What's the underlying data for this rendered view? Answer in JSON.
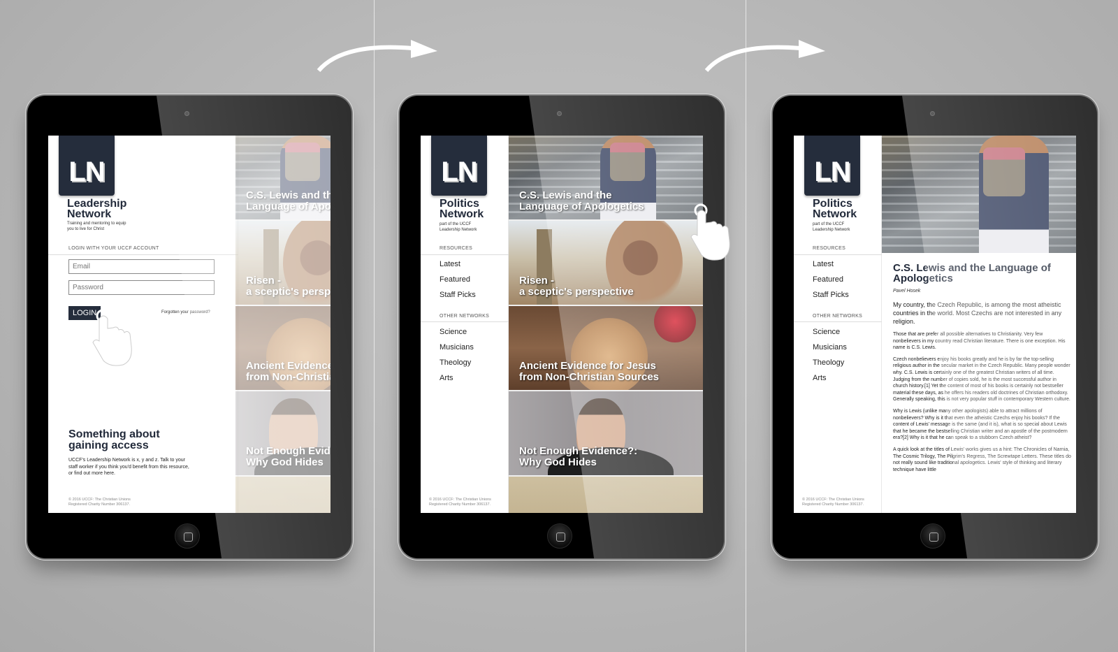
{
  "brand_color": "#252d3c",
  "panels": [
    {
      "screen": "login",
      "logo": "LN",
      "brand_name": "Leadership Network",
      "brand_tagline": "Training and mentoring to equip you to live for Christ",
      "login": {
        "section_label": "LOGIN WITH YOUR UCCF ACCOUNT",
        "email_placeholder": "Email",
        "password_placeholder": "Password",
        "login_button": "LOGIN",
        "forgot_link": "Forgotten your password?"
      },
      "access": {
        "title": "Something about gaining access",
        "text": "UCCF's Leadership Network is x, y and z. Talk to your staff worker if you think you'd benefit from this resource, or find out more here."
      },
      "footer": [
        "© 2016 UCCF: The Christian Unions",
        "Registered Charity Number 306137."
      ]
    },
    {
      "screen": "listing",
      "logo": "LN",
      "brand_name": "Politics Network",
      "brand_tagline": "part of the UCCF Leadership Network",
      "resources_label": "RESOURCES",
      "resources": [
        "Latest",
        "Featured",
        "Staff Picks"
      ],
      "other_networks_label": "OTHER NETWORKS",
      "other_networks": [
        "Science",
        "Musicians",
        "Theology",
        "Arts"
      ],
      "footer": [
        "© 2016 UCCF: The Christian Unions",
        "Registered Charity Number 306137."
      ]
    },
    {
      "screen": "article",
      "logo": "LN",
      "brand_name": "Politics Network",
      "brand_tagline": "part of the UCCF Leadership Network",
      "resources_label": "RESOURCES",
      "resources": [
        "Latest",
        "Featured",
        "Staff Picks"
      ],
      "other_networks_label": "OTHER NETWORKS",
      "other_networks": [
        "Science",
        "Musicians",
        "Theology",
        "Arts"
      ],
      "footer": [
        "© 2016 UCCF: The Christian Unions",
        "Registered Charity Number 306137."
      ],
      "article": {
        "title": "C.S. Lewis and the Language of Apologetics",
        "author": "Pavel Hosek",
        "lead": "My country, the Czech Republic, is among the most atheistic countries in the world. Most Czechs are not interested in any religion.",
        "paragraphs": [
          "Those that are prefer all possible alternatives to Christianity. Very few nonbelievers in my country read Christian literature. There is one exception. His name is C.S. Lewis.",
          "Czech nonbelievers enjoy his books greatly and he is by far the top-selling religious author in the secular market in the Czech Republic. Many people wonder why. C.S. Lewis is certainly one of the greatest Christian writers of all time. Judging from the number of copies sold, he is the most successful author in church history.[1] Yet the content of most of his books is certainly not bestseller material these days, as he offers his readers old doctrines of Christian orthodoxy. Generally speaking, this is not very popular stuff in contemporary Western culture.",
          "Why is Lewis (unlike many other apologists) able to attract millions of nonbelievers? Why is it that even the atheistic Czechs enjoy his books? If the content of Lewis' message is the same (and it is), what is so special about Lewis that he became the bestselling Christian writer and an apostle of the postmodern era?[2] Why is it that he can speak to a stubborn Czech atheist?",
          "A quick look at the titles of Lewis' works gives us a hint: The Chronicles of Narnia, The Cosmic Trilogy, The Pilgrim's Regress, The Screwtape Letters. These titles do not really sound like traditional apologetics. Lewis' style of thinking and literary technique have little"
        ]
      }
    }
  ],
  "cards": [
    {
      "title_line1": "C.S. Lewis and the",
      "title_line2": "Language of Apologetics",
      "image": "stairs"
    },
    {
      "title_line1": "Risen -",
      "title_line2": "a sceptic's perspective",
      "image": "parliament"
    },
    {
      "title_line1": "Ancient Evidence for Jesus",
      "title_line2": "from Non-Christian Sources",
      "image": "bread"
    },
    {
      "title_line1": "Not Enough Evidence?:",
      "title_line2": "Why God Hides",
      "image": "man"
    },
    {
      "title_line1": "",
      "title_line2": "",
      "image": "crown"
    }
  ]
}
